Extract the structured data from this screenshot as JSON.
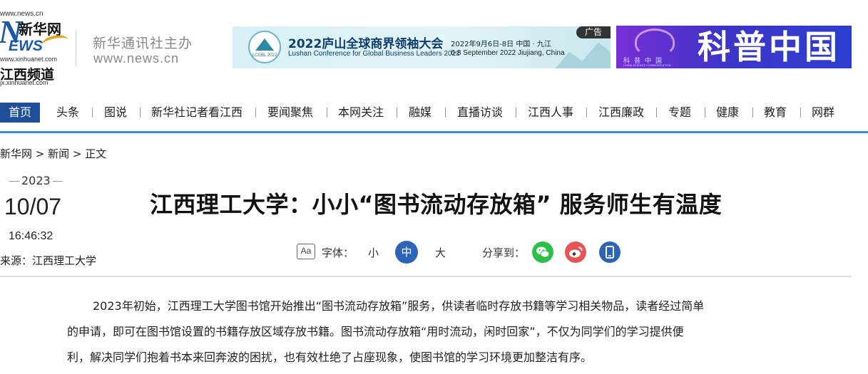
{
  "logo": {
    "site_url": "www.news.cn",
    "brand_cn": "新华网",
    "letter_n": "N",
    "letters_ews": "EWS",
    "domain": "www.xinhuanet.com",
    "channel": "江西频道",
    "domain2": "jx.xinhuanet.com"
  },
  "header": {
    "host": "新华通讯社主办",
    "host_url": "www.news.cn"
  },
  "ad1": {
    "badge": "LCGBL 2022",
    "title_cn": "2022庐山全球商界领袖大会",
    "title_en": "Lushan Conference for Global Business Leaders 2022",
    "date_cn": "2022年9月6日-8日  中国 · 九江",
    "date_en": "6-8 September 2022  Jiujiang, China",
    "tag": "广告"
  },
  "ad2": {
    "small": "科普中国",
    "tiny": "CHINA SCIENCE COMMUNICATION",
    "big": "科普中国"
  },
  "nav": {
    "items": [
      "首页",
      "头条",
      "图说",
      "新华社记者看江西",
      "要闻聚焦",
      "本网关注",
      "融媒",
      "直播访谈",
      "江西人事",
      "江西廉政",
      "专题",
      "健康",
      "教育",
      "网群"
    ]
  },
  "breadcrumb": "新华网 > 新闻 > 正文",
  "article": {
    "year": "2023",
    "month_day": "10/07",
    "time": "16:46:32",
    "source": "来源：江西理工大学",
    "title": "江西理工大学：小小“图书流动存放箱” 服务师生有温度"
  },
  "tools": {
    "font_icon": "Aa",
    "font_label": "字体：",
    "size_small": "小",
    "size_medium": "中",
    "size_large": "大",
    "share_label": "分享到：",
    "share_icons": [
      "wechat-icon",
      "weibo-icon",
      "mobile-icon"
    ]
  },
  "body": {
    "line1": "2023年初始，江西理工大学图书馆开始推出“图书流动存放箱”服务，供读者临时存放书籍等学习相关物品，读者经过简单",
    "line2": "的申请，即可在图书馆设置的书籍存放区域存放书籍。图书流动存放箱“用时流动，闲时回家”，不仅为同学们的学习提供便",
    "line3": "利，解决同学们抱着书本来回奔波的困扰，也有效杜绝了占座现象，使图书馆的学习环境更加整洁有序。"
  },
  "colors": {
    "nav_active": "#1f4f98",
    "nav_underline": "#3b8fd9",
    "size_active": "#2b64b8",
    "wechat": "#2cc04a",
    "weibo": "#e85454"
  }
}
